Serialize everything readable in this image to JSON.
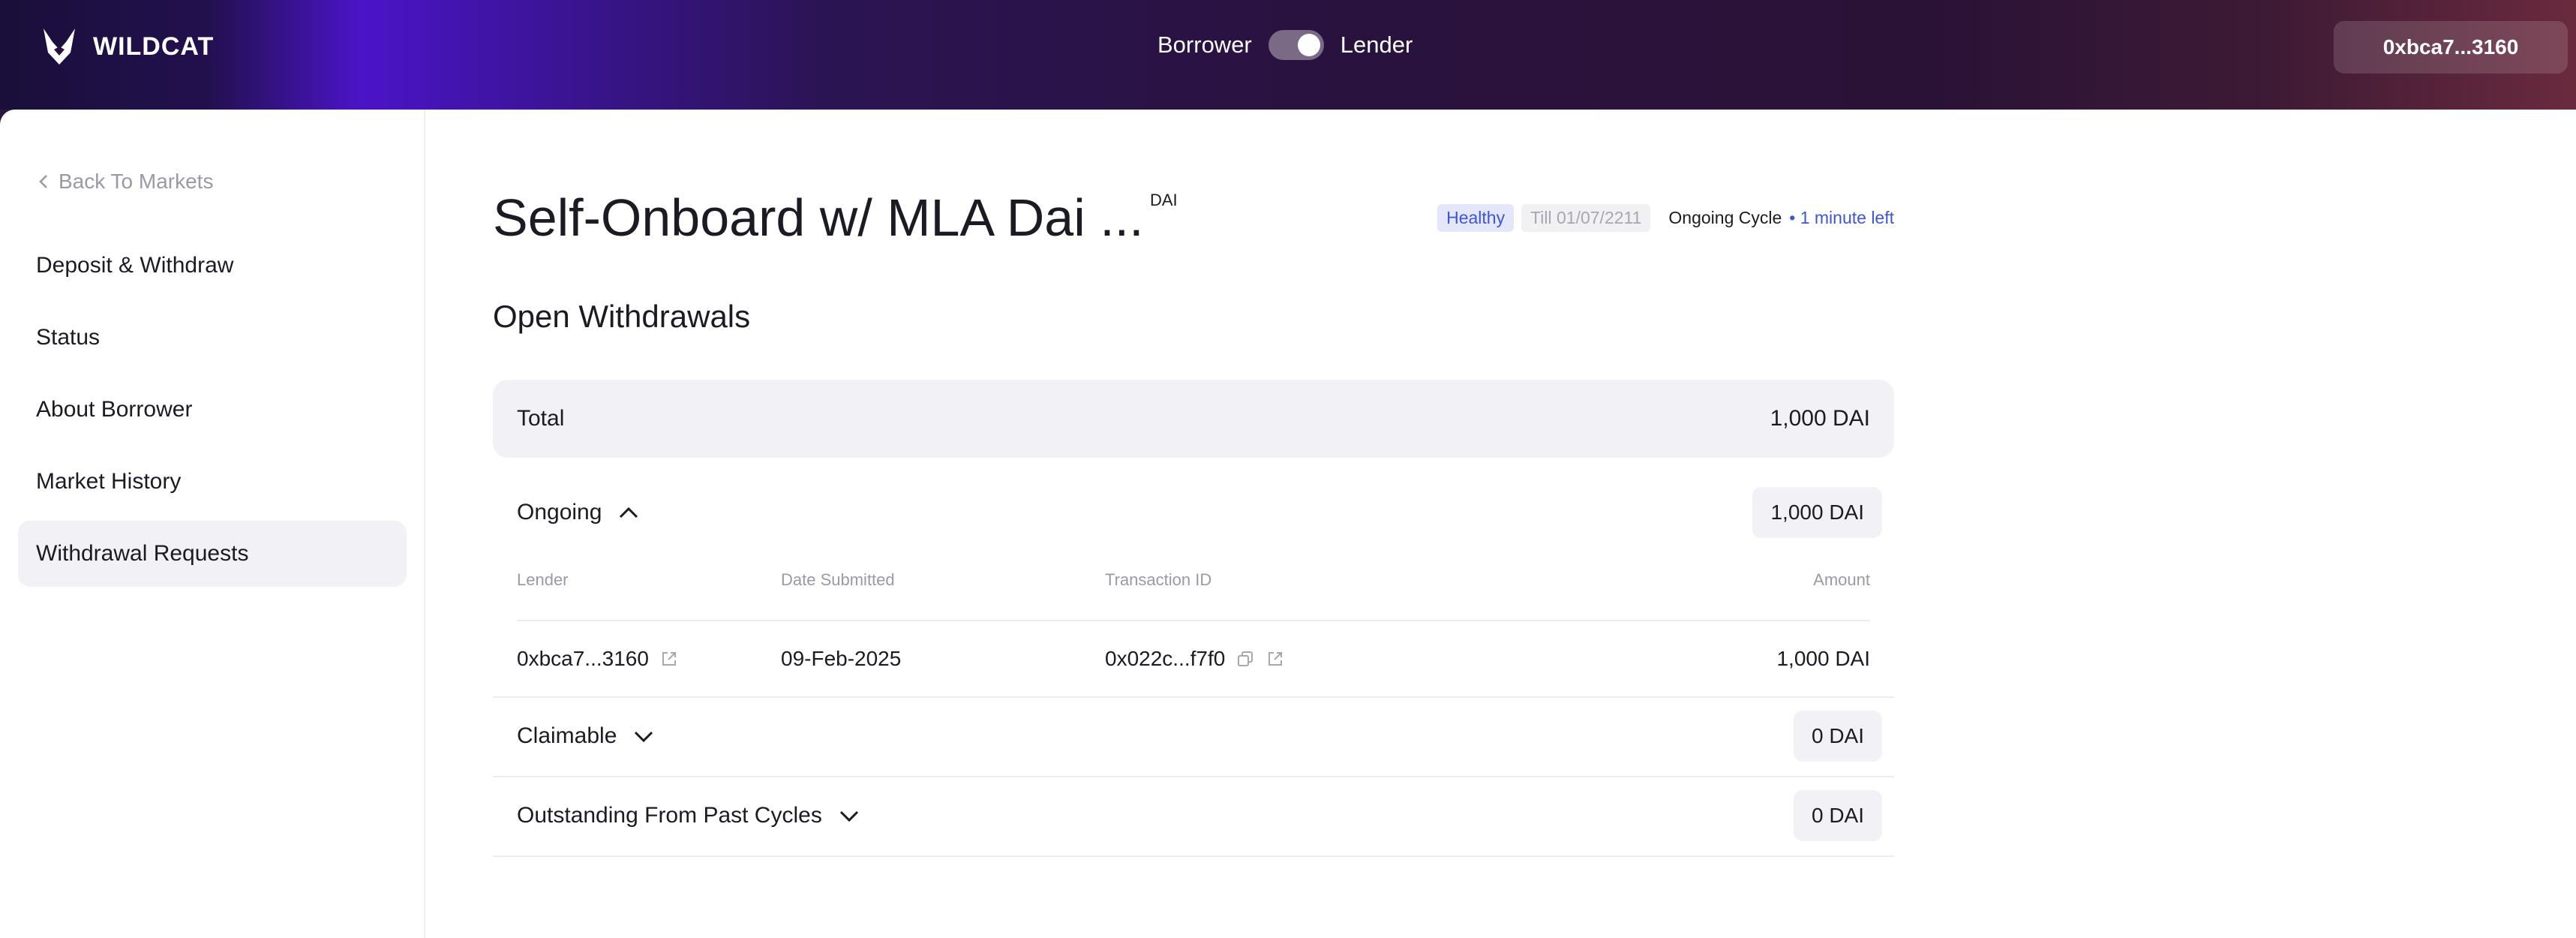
{
  "header": {
    "brand": "WILDCAT",
    "role_left": "Borrower",
    "role_right": "Lender",
    "wallet": "0xbca7...3160"
  },
  "sidebar": {
    "back_label": "Back To Markets",
    "items": [
      {
        "label": "Deposit & Withdraw"
      },
      {
        "label": "Status"
      },
      {
        "label": "About Borrower"
      },
      {
        "label": "Market History"
      },
      {
        "label": "Withdrawal Requests",
        "active": true
      }
    ]
  },
  "market": {
    "title": "Self-Onboard w/ MLA Dai ...",
    "asset": "DAI",
    "health": "Healthy",
    "till": "Till 01/07/2211",
    "cycle": "Ongoing Cycle",
    "cycle_left": "• 1 minute left"
  },
  "withdrawals": {
    "section_title": "Open Withdrawals",
    "total_label": "Total",
    "total_value": "1,000 DAI",
    "ongoing": {
      "label": "Ongoing",
      "value": "1,000 DAI",
      "columns": [
        "Lender",
        "Date Submitted",
        "Transaction ID",
        "Amount"
      ],
      "rows": [
        {
          "lender": "0xbca7...3160",
          "date": "09-Feb-2025",
          "tx": "0x022c...f7f0",
          "amount": "1,000 DAI"
        }
      ]
    },
    "claimable": {
      "label": "Claimable",
      "value": "0 DAI"
    },
    "outstanding": {
      "label": "Outstanding From Past Cycles",
      "value": "0 DAI"
    }
  },
  "colors": {
    "accent": "#3d55d8",
    "header_purple": "#4b14c8",
    "panel_gray": "#f2f2f6"
  }
}
